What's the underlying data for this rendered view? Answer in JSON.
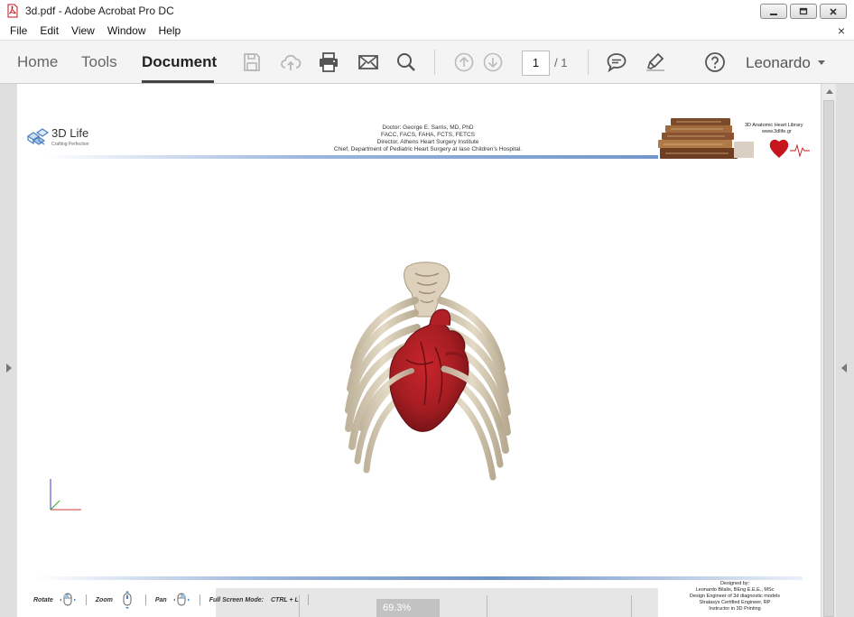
{
  "window": {
    "title": "3d.pdf - Adobe Acrobat Pro DC",
    "controls": [
      "minimize",
      "restore",
      "close"
    ]
  },
  "menu": {
    "items": [
      "File",
      "Edit",
      "View",
      "Window",
      "Help"
    ],
    "close_glyph": "×"
  },
  "toolbar": {
    "tabs": [
      {
        "label": "Home",
        "active": false
      },
      {
        "label": "Tools",
        "active": false
      },
      {
        "label": "Document",
        "active": true
      }
    ],
    "icons": [
      "save-icon",
      "upload-icon",
      "print-icon",
      "mail-icon",
      "search-icon",
      "page-up-icon",
      "page-down-icon",
      "comment-icon",
      "highlight-icon",
      "help-icon"
    ],
    "page_current": "1",
    "page_total": "/ 1",
    "user": "Leonardo"
  },
  "document": {
    "header": {
      "brand": "3D Life",
      "tagline": "Crafting Perfection",
      "doctor_lines": [
        "Doctor: George E. Sarris, MD, PhD",
        "FACC, FACS, FAHA, FCTS, FETCS",
        "Director, Athens Heart Surgery Institute",
        "Chief, Department of Pediatric Heart Surgery at Iaso Children's Hospital."
      ],
      "library_title": "3D Anatomic Heart Library",
      "library_url": "www.3dlife.gr"
    },
    "controls": {
      "rotate": "Rotate",
      "zoom": "Zoom",
      "pan": "Pan",
      "fullscreen_label": "Full Screen Mode:",
      "fullscreen_key": "CTRL + L"
    },
    "hud_zoom": "69.3%",
    "credits": [
      "Designed by:",
      "Leonardo Bilalis, BEng E.E.E., MSc",
      "Design Engineer of 3d diagnostic models",
      "Stratasys Certified Engineer, RP",
      "Instructor in 3D Printing"
    ]
  },
  "colors": {
    "bone": "#d6cbb5",
    "heart": "#a51d22",
    "accent_line": "#6f93c9"
  }
}
